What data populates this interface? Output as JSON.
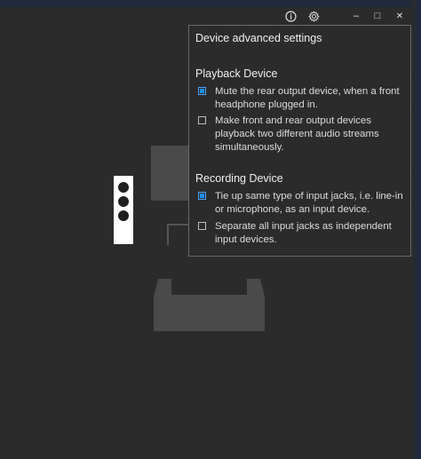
{
  "window": {
    "info_icon": "info-icon",
    "settings_icon": "gear-icon",
    "minimize_glyph": "–",
    "maximize_glyph": "□",
    "close_glyph": "✕"
  },
  "panel": {
    "title": "Device advanced settings",
    "playback": {
      "heading": "Playback Device",
      "options": [
        {
          "label": "Mute the rear output device, when a front headphone plugged in.",
          "checked": true
        },
        {
          "label": "Make front and rear output devices playback two different audio streams simultaneously.",
          "checked": false
        }
      ]
    },
    "recording": {
      "heading": "Recording Device",
      "options": [
        {
          "label": "Tie up same type of input jacks, i.e. line-in or microphone, as an input device.",
          "checked": true
        },
        {
          "label": "Separate all input jacks as independent input devices.",
          "checked": false
        }
      ]
    }
  },
  "colors": {
    "background": "#2b2b2b",
    "accent": "#1e90ff",
    "panel_border": "#6a6a6a",
    "speaker": "#ffffff"
  }
}
